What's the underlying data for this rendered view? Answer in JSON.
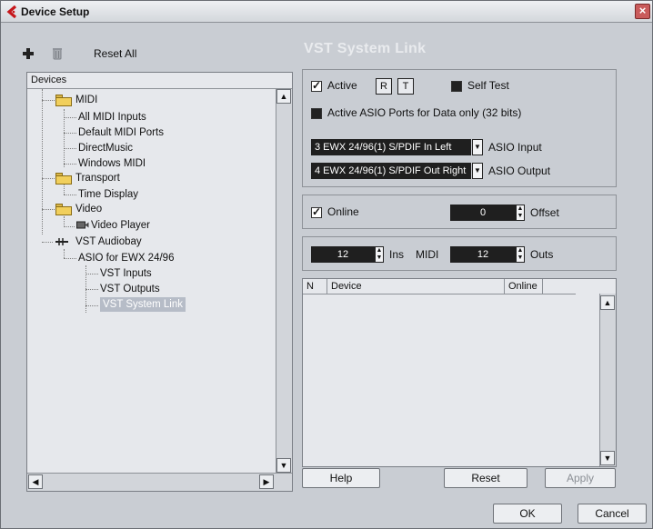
{
  "window": {
    "title": "Device Setup",
    "close_glyph": "×"
  },
  "toolbar": {
    "add_icon": "plus-icon",
    "remove_icon": "trash-icon",
    "reset_all_label": "Reset All"
  },
  "tree": {
    "header": "Devices",
    "items": [
      {
        "label": "MIDI",
        "type": "folder"
      },
      {
        "label": "All MIDI Inputs",
        "type": "leaf"
      },
      {
        "label": "Default MIDI Ports",
        "type": "leaf"
      },
      {
        "label": "DirectMusic",
        "type": "leaf"
      },
      {
        "label": "Windows MIDI",
        "type": "leaf"
      },
      {
        "label": "Transport",
        "type": "folder"
      },
      {
        "label": "Time Display",
        "type": "leaf"
      },
      {
        "label": "Video",
        "type": "folder"
      },
      {
        "label": "Video Player",
        "type": "leaf",
        "icon": "video-player-icon"
      },
      {
        "label": "VST Audiobay",
        "type": "node",
        "icon": "audiobay-icon"
      },
      {
        "label": "ASIO for EWX 24/96",
        "type": "leaf"
      },
      {
        "label": "VST Inputs",
        "type": "leaf"
      },
      {
        "label": "VST Outputs",
        "type": "leaf"
      },
      {
        "label": "VST System Link",
        "type": "leaf",
        "selected": true
      }
    ]
  },
  "panel": {
    "title": "VST System Link",
    "active_label": "Active",
    "active_checked": true,
    "r_label": "R",
    "t_label": "T",
    "self_test_label": "Self Test",
    "asio_ports_label": "Active ASIO Ports for Data only (32 bits)",
    "asio_input_value": "3 EWX 24/96(1) S/PDIF In Left",
    "asio_input_label": "ASIO Input",
    "asio_output_value": "4 EWX 24/96(1) S/PDIF Out Right",
    "asio_output_label": "ASIO Output",
    "online_label": "Online",
    "online_checked": true,
    "offset_value": "0",
    "offset_label": "Offset",
    "ins_value": "12",
    "ins_label": "Ins",
    "midi_label": "MIDI",
    "outs_value": "12",
    "outs_label": "Outs",
    "list_columns": [
      "N",
      "Device",
      "Online"
    ]
  },
  "buttons": {
    "help": "Help",
    "reset": "Reset",
    "apply": "Apply",
    "ok": "OK",
    "cancel": "Cancel"
  },
  "colors": {
    "window_bg": "#c9cdd3",
    "field_bg": "#1f1f1f",
    "selection": "#b6bcc7"
  }
}
